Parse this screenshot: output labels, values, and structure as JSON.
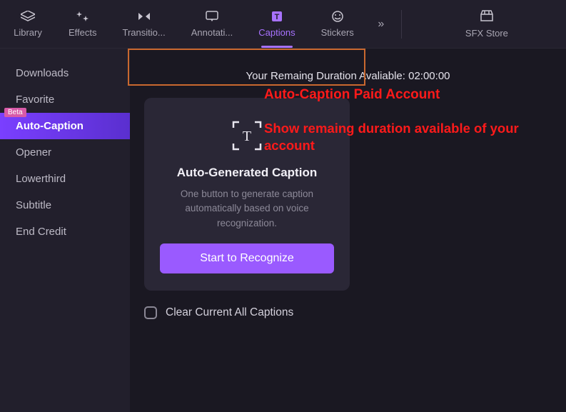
{
  "topbar": {
    "tabs": [
      {
        "label": "Library"
      },
      {
        "label": "Effects"
      },
      {
        "label": "Transitio..."
      },
      {
        "label": "Annotati..."
      },
      {
        "label": "Captions"
      },
      {
        "label": "Stickers"
      }
    ],
    "sfx_label": "SFX Store"
  },
  "sidebar": {
    "items": [
      {
        "label": "Downloads"
      },
      {
        "label": "Favorite"
      },
      {
        "label": "Auto-Caption",
        "badge": "Beta"
      },
      {
        "label": "Opener"
      },
      {
        "label": "Lowerthird"
      },
      {
        "label": "Subtitle"
      },
      {
        "label": "End Credit"
      }
    ]
  },
  "main": {
    "duration_text": "Your Remaing Duration Avaliable: 02:00:00",
    "card": {
      "title": "Auto-Generated Caption",
      "desc": "One button to generate caption automatically based on voice recognization.",
      "button": "Start to Recognize"
    },
    "clear_label": "Clear Current All Captions"
  },
  "annotations": {
    "a1": "Auto-Caption Paid Account",
    "a2": "Show remaing duration available of your account"
  }
}
